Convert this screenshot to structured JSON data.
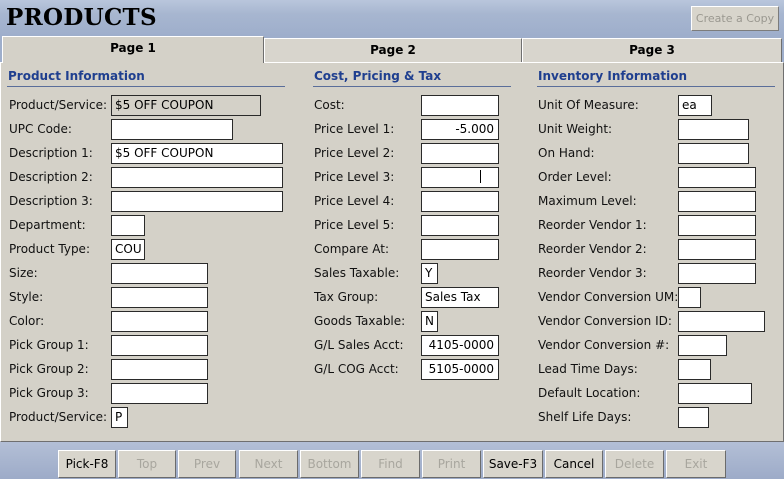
{
  "header": {
    "title": "PRODUCTS",
    "copy_button": "Create a Copy"
  },
  "tabs": [
    "Page 1",
    "Page 2",
    "Page 3"
  ],
  "sections": {
    "product": "Product Information",
    "cost": "Cost, Pricing & Tax",
    "inventory": "Inventory Information"
  },
  "product_fields": [
    {
      "label": "Product/Service:",
      "value": "$5 OFF COUPON"
    },
    {
      "label": "UPC Code:",
      "value": ""
    },
    {
      "label": "Description 1:",
      "value": "$5 OFF COUPON"
    },
    {
      "label": "Description 2:",
      "value": ""
    },
    {
      "label": "Description 3:",
      "value": ""
    },
    {
      "label": "Department:",
      "value": ""
    },
    {
      "label": "Product Type:",
      "value": "COU"
    },
    {
      "label": "Size:",
      "value": ""
    },
    {
      "label": "Style:",
      "value": ""
    },
    {
      "label": "Color:",
      "value": ""
    },
    {
      "label": "Pick Group 1:",
      "value": ""
    },
    {
      "label": "Pick Group 2:",
      "value": ""
    },
    {
      "label": "Pick Group 3:",
      "value": ""
    },
    {
      "label": "Product/Service:",
      "value": "P"
    }
  ],
  "cost_fields": [
    {
      "label": "Cost:",
      "value": ""
    },
    {
      "label": "Price Level 1:",
      "value": "-5.000"
    },
    {
      "label": "Price Level 2:",
      "value": ""
    },
    {
      "label": "Price Level 3:",
      "value": ""
    },
    {
      "label": "Price Level 4:",
      "value": ""
    },
    {
      "label": "Price Level 5:",
      "value": ""
    },
    {
      "label": "Compare At:",
      "value": ""
    },
    {
      "label": "Sales Taxable:",
      "value": "Y"
    },
    {
      "label": "Tax Group:",
      "value": "Sales Tax"
    },
    {
      "label": "Goods Taxable:",
      "value": "N"
    },
    {
      "label": "G/L Sales Acct:",
      "value": "4105-0000"
    },
    {
      "label": "G/L COG Acct:",
      "value": "5105-0000"
    }
  ],
  "inventory_fields": [
    {
      "label": "Unit Of Measure:",
      "value": "ea"
    },
    {
      "label": "Unit Weight:",
      "value": ""
    },
    {
      "label": "On Hand:",
      "value": ""
    },
    {
      "label": "Order Level:",
      "value": ""
    },
    {
      "label": "Maximum Level:",
      "value": ""
    },
    {
      "label": "Reorder Vendor 1:",
      "value": ""
    },
    {
      "label": "Reorder Vendor 2:",
      "value": ""
    },
    {
      "label": "Reorder Vendor 3:",
      "value": ""
    },
    {
      "label": "Vendor Conversion UM:",
      "value": ""
    },
    {
      "label": "Vendor Conversion ID:",
      "value": ""
    },
    {
      "label": "Vendor Conversion #:",
      "value": ""
    },
    {
      "label": "Lead Time Days:",
      "value": ""
    },
    {
      "label": "Default Location:",
      "value": ""
    },
    {
      "label": "Shelf Life Days:",
      "value": ""
    }
  ],
  "buttons": [
    "Pick-F8",
    "Top",
    "Prev",
    "Next",
    "Bottom",
    "Find",
    "Print",
    "Save-F3",
    "Cancel",
    "Delete",
    "Exit"
  ]
}
